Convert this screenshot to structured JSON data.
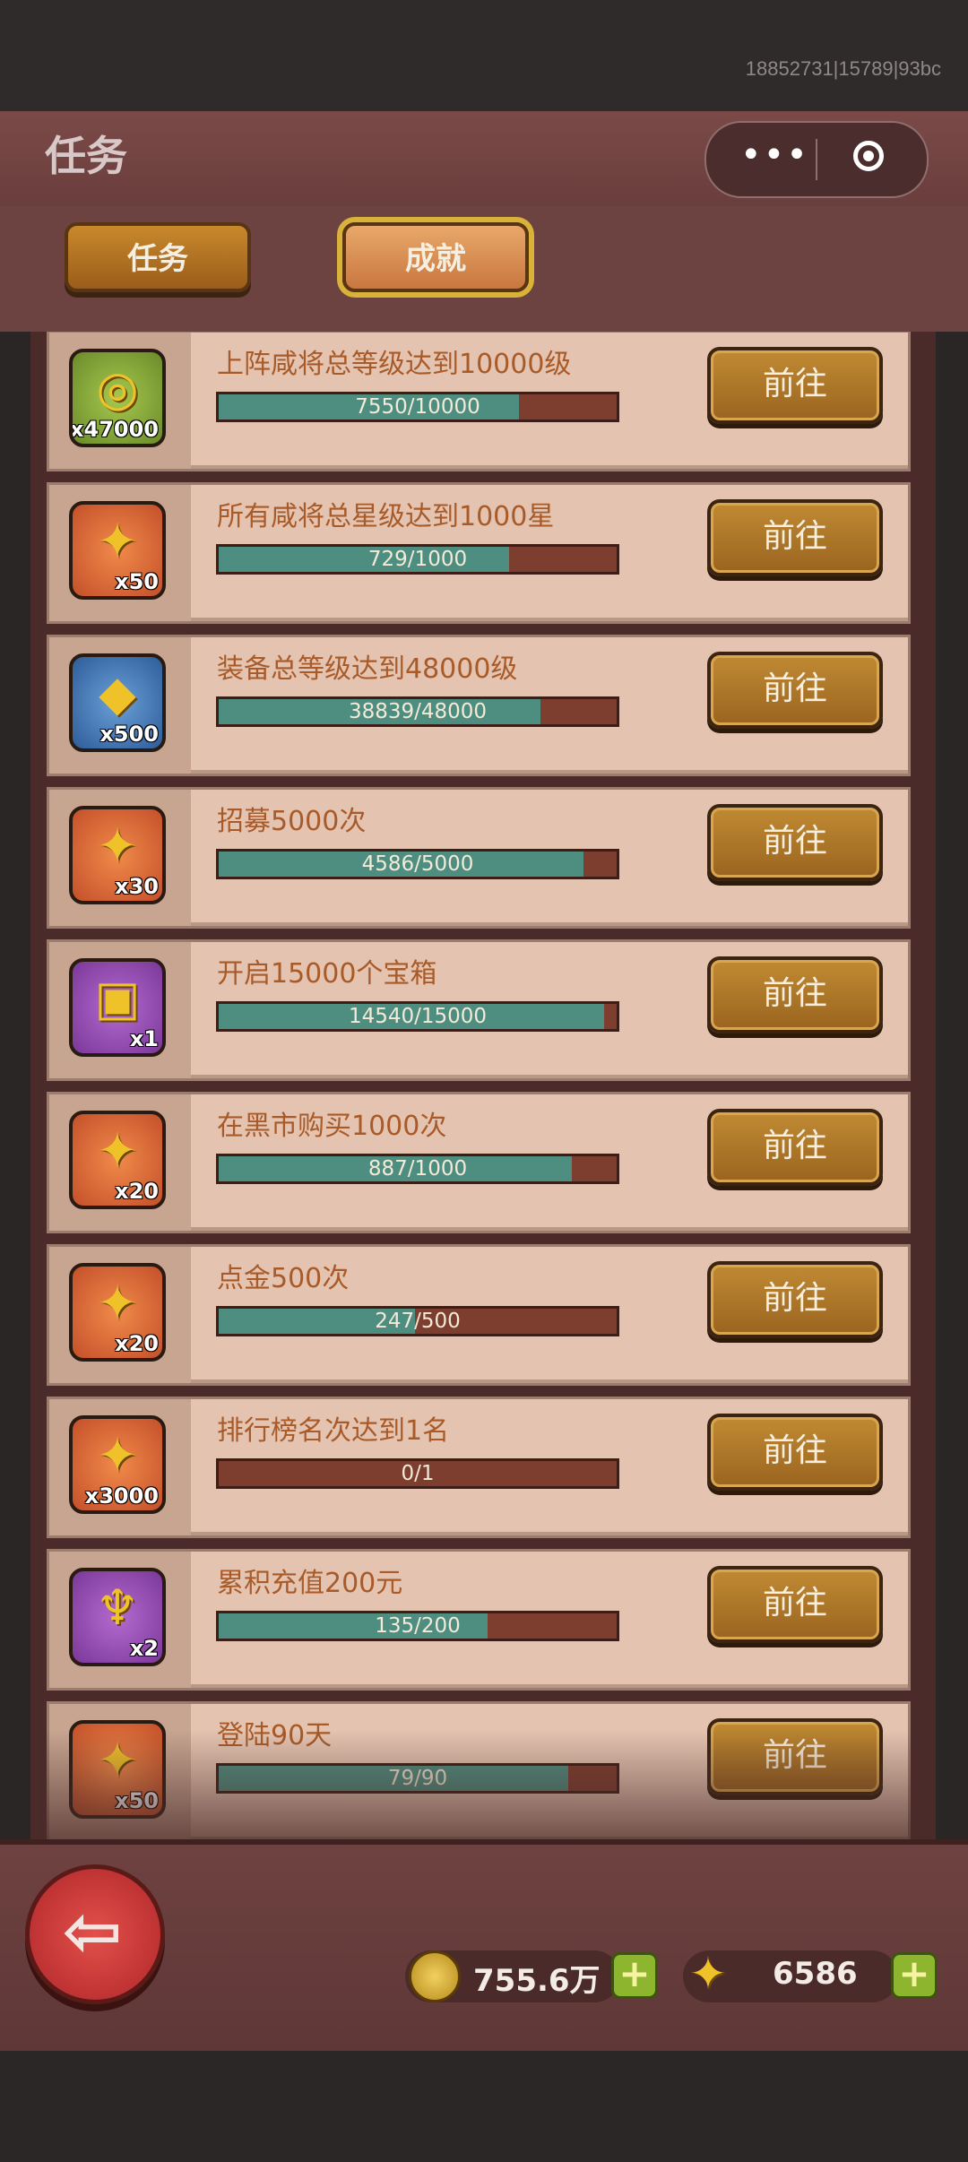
{
  "header": {
    "uid": "18852731|15789|93bc",
    "title": "任务"
  },
  "capsule": {
    "more_icon": "more-dots-icon",
    "close_icon": "target-icon",
    "more_glyph": "•••"
  },
  "tabs": [
    {
      "label": "任务"
    },
    {
      "label": "成就"
    }
  ],
  "achievements": [
    {
      "name": "上阵咸将总等级达到10000级",
      "progress_text": "7550/10000",
      "progress": 0.755,
      "reward_qty": "x47000",
      "reward_icon": "coin-icon",
      "icon_color": "green",
      "button": "前往"
    },
    {
      "name": "所有咸将总星级达到1000星",
      "progress_text": "729/1000",
      "progress": 0.729,
      "reward_qty": "x50",
      "reward_icon": "ticket-icon",
      "icon_color": "orange",
      "button": "前往"
    },
    {
      "name": "装备总等级达到48000级",
      "progress_text": "38839/48000",
      "progress": 0.809,
      "reward_qty": "x500",
      "reward_icon": "ore-icon",
      "icon_color": "blue",
      "button": "前往"
    },
    {
      "name": "招募5000次",
      "progress_text": "4586/5000",
      "progress": 0.917,
      "reward_qty": "x30",
      "reward_icon": "ticket-icon",
      "icon_color": "orange",
      "button": "前往"
    },
    {
      "name": "开启15000个宝箱",
      "progress_text": "14540/15000",
      "progress": 0.969,
      "reward_qty": "x1",
      "reward_icon": "chest-icon",
      "icon_color": "purple",
      "button": "前往"
    },
    {
      "name": "在黑市购买1000次",
      "progress_text": "887/1000",
      "progress": 0.887,
      "reward_qty": "x20",
      "reward_icon": "ticket-icon",
      "icon_color": "orange",
      "button": "前往"
    },
    {
      "name": "点金500次",
      "progress_text": "247/500",
      "progress": 0.494,
      "reward_qty": "x20",
      "reward_icon": "ticket-icon",
      "icon_color": "orange",
      "button": "前往"
    },
    {
      "name": "排行榜名次达到1名",
      "progress_text": "0/1",
      "progress": 0,
      "reward_qty": "x3000",
      "reward_icon": "ticket-icon",
      "icon_color": "orange",
      "button": "前往"
    },
    {
      "name": "累积充值200元",
      "progress_text": "135/200",
      "progress": 0.675,
      "reward_qty": "x2",
      "reward_icon": "torch-icon",
      "icon_color": "purple",
      "button": "前往"
    },
    {
      "name": "登陆90天",
      "progress_text": "79/90",
      "progress": 0.878,
      "reward_qty": "x50",
      "reward_icon": "ticket-icon",
      "icon_color": "orange",
      "button": "前往"
    }
  ],
  "footer": {
    "coins": "755.6万",
    "tickets": "6586",
    "back_icon": "back-arrow-icon",
    "back_glyph": "⇦",
    "plus_glyph": "+"
  },
  "colors": {
    "bar_fill": "#4e8e80",
    "bar_track": "#7d3d2f",
    "title_text": "#a85a28"
  }
}
